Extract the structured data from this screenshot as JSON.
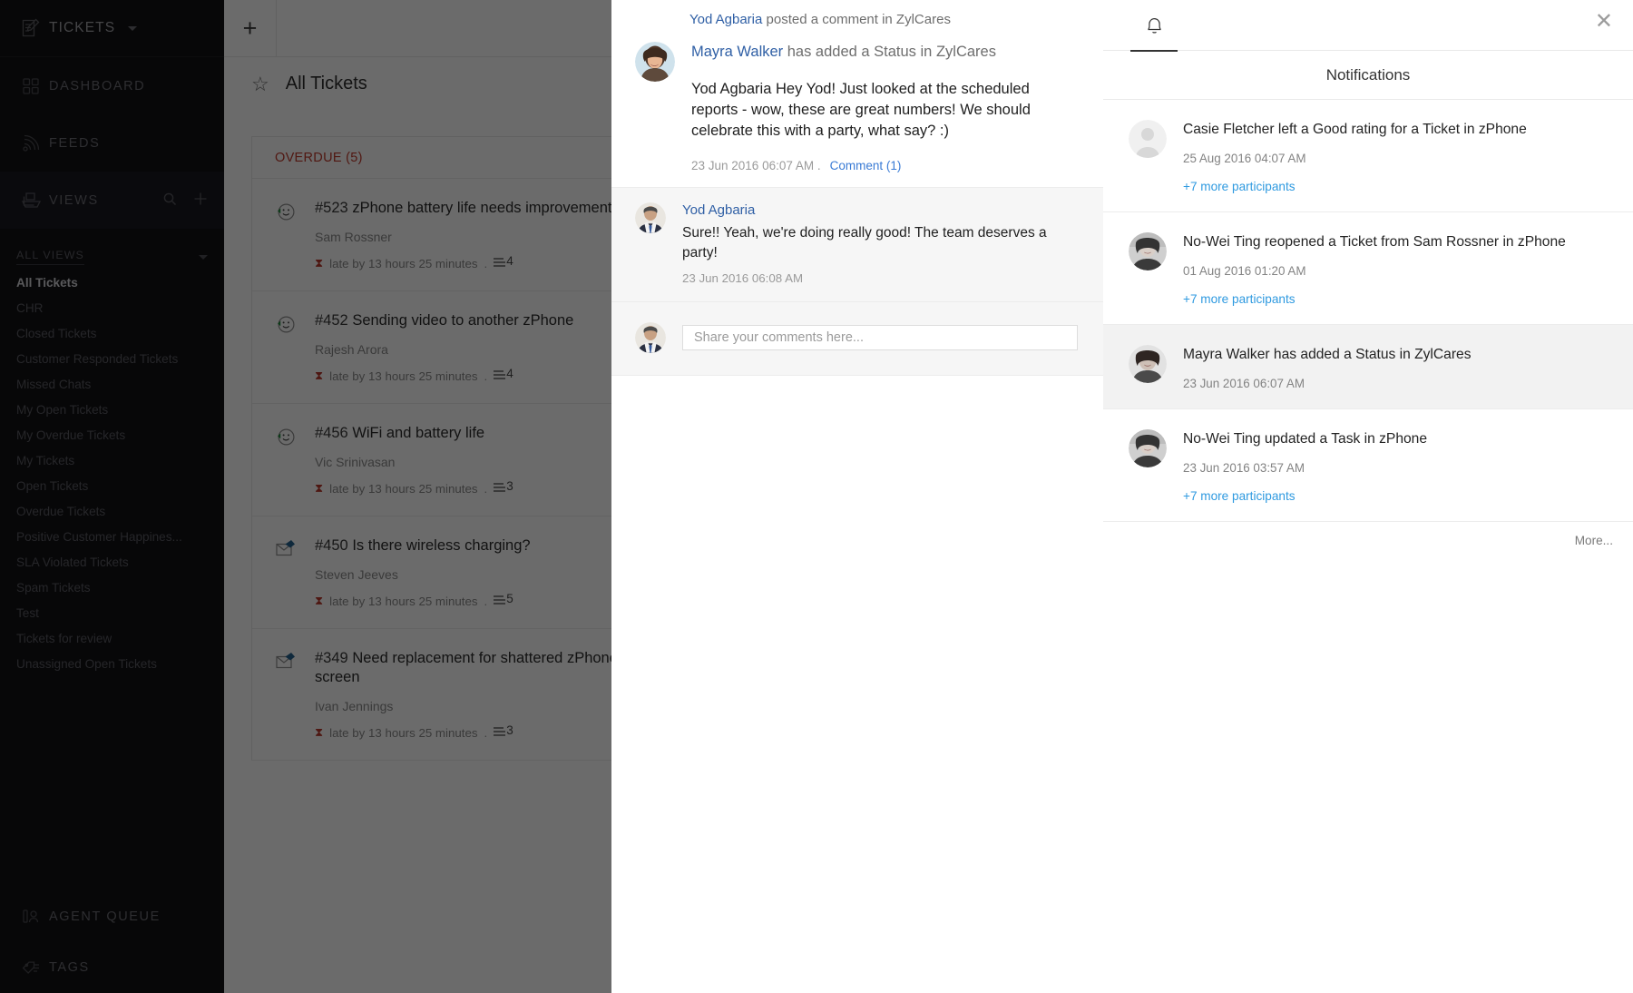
{
  "sidebar": {
    "brand": {
      "label": "TICKETS",
      "icon": "compose-ticket-icon",
      "caret": "chevron-down-icon"
    },
    "nav": [
      {
        "label": "DASHBOARD",
        "icon": "dashboard-grid-icon"
      },
      {
        "label": "FEEDS",
        "icon": "feeds-rss-icon"
      },
      {
        "label": "VIEWS",
        "icon": "views-stack-icon",
        "search_icon": "search-icon",
        "add_icon": "plus-icon"
      }
    ],
    "all_views_label": "ALL VIEWS",
    "views": [
      {
        "label": "All Tickets",
        "selected": true
      },
      {
        "label": "CHR",
        "selected": false
      },
      {
        "label": "Closed Tickets",
        "selected": false
      },
      {
        "label": "Customer Responded Tickets",
        "selected": false
      },
      {
        "label": "Missed Chats",
        "selected": false
      },
      {
        "label": "My Open Tickets",
        "selected": false
      },
      {
        "label": "My Overdue Tickets",
        "selected": false
      },
      {
        "label": "My Tickets",
        "selected": false
      },
      {
        "label": "Open Tickets",
        "selected": false
      },
      {
        "label": "Overdue Tickets",
        "selected": false
      },
      {
        "label": "Positive Customer Happines...",
        "selected": false
      },
      {
        "label": "SLA Violated Tickets",
        "selected": false
      },
      {
        "label": "Spam Tickets",
        "selected": false
      },
      {
        "label": "Test",
        "selected": false
      },
      {
        "label": "Tickets for review",
        "selected": false
      },
      {
        "label": "Unassigned Open Tickets",
        "selected": false
      }
    ],
    "bottom": [
      {
        "label": "AGENT QUEUE",
        "icon": "agent-queue-icon"
      },
      {
        "label": "TAGS",
        "icon": "tag-icon"
      }
    ]
  },
  "tickets": {
    "add_label": "+",
    "star_icon": "star-outline-icon",
    "view_title": "All Tickets",
    "group_label": "OVERDUE (5)",
    "rows": [
      {
        "icon": "happy-face-icon",
        "number": "#523",
        "title": "zPhone battery life needs improvement",
        "requester": "Sam Rossner",
        "due": "late by 13 hours 25 minutes",
        "threads": "4"
      },
      {
        "icon": "happy-face-icon",
        "number": "#452",
        "title": "Sending video to another zPhone",
        "requester": "Rajesh Arora",
        "due": "late by 13 hours 25 minutes",
        "threads": "4"
      },
      {
        "icon": "happy-face-icon",
        "number": "#456",
        "title": "WiFi and battery life",
        "requester": "Vic Srinivasan",
        "due": "late by 13 hours 25 minutes",
        "threads": "3"
      },
      {
        "icon": "email-icon",
        "number": "#450",
        "title": "Is there wireless charging?",
        "requester": "Steven Jeeves",
        "due": "late by 13 hours 25 minutes",
        "threads": "5"
      },
      {
        "icon": "email-icon",
        "number": "#349",
        "title": "Need replacement for shattered zPhone screen",
        "requester": "Ivan Jennings",
        "due": "late by 13 hours 25 minutes",
        "threads": "3"
      }
    ]
  },
  "detail": {
    "header": {
      "actor": "Yod Agbaria",
      "rest": " posted a comment in ZylCares"
    },
    "post": {
      "actor": "Mayra Walker",
      "action": " has added a Status in ZylCares",
      "message": "Yod Agbaria Hey Yod! Just looked at the scheduled reports - wow, these are great numbers! We should celebrate this with a party, what say? :)",
      "timestamp": "23 Jun 2016 06:07 AM  .",
      "comment_link": "Comment (1)"
    },
    "reply": {
      "author": "Yod Agbaria",
      "message": "Sure!! Yeah, we're doing really good! The team deserves a party!",
      "timestamp": "23 Jun 2016 06:08 AM"
    },
    "compose": {
      "placeholder": "Share your comments here..."
    }
  },
  "notifications": {
    "bell_icon": "bell-icon",
    "close_icon": "close-icon",
    "title": "Notifications",
    "more_label": "More...",
    "items": [
      {
        "text": "Casie Fletcher left a Good rating for a Ticket in zPhone",
        "time": "25 Aug 2016 04:07 AM",
        "participants": "+7 more participants",
        "avatar": "placeholder",
        "highlighted": false
      },
      {
        "text": "No-Wei Ting reopened a Ticket from Sam Rossner in zPhone",
        "time": "01 Aug 2016 01:20 AM",
        "participants": "+7 more participants",
        "avatar": "nowei",
        "highlighted": false
      },
      {
        "text": "Mayra Walker has added a Status in ZylCares",
        "time": "23 Jun 2016 06:07 AM",
        "participants": "",
        "avatar": "mayra",
        "highlighted": true
      },
      {
        "text": "No-Wei Ting updated a Task in zPhone",
        "time": "23 Jun 2016 03:57 AM",
        "participants": "+7 more participants",
        "avatar": "nowei",
        "highlighted": false
      }
    ]
  },
  "colors": {
    "sidebar_bg": "#111114",
    "overdue_red": "#c0392b",
    "link_blue": "#2f5fa5",
    "participant_blue": "#2f9ae0"
  }
}
